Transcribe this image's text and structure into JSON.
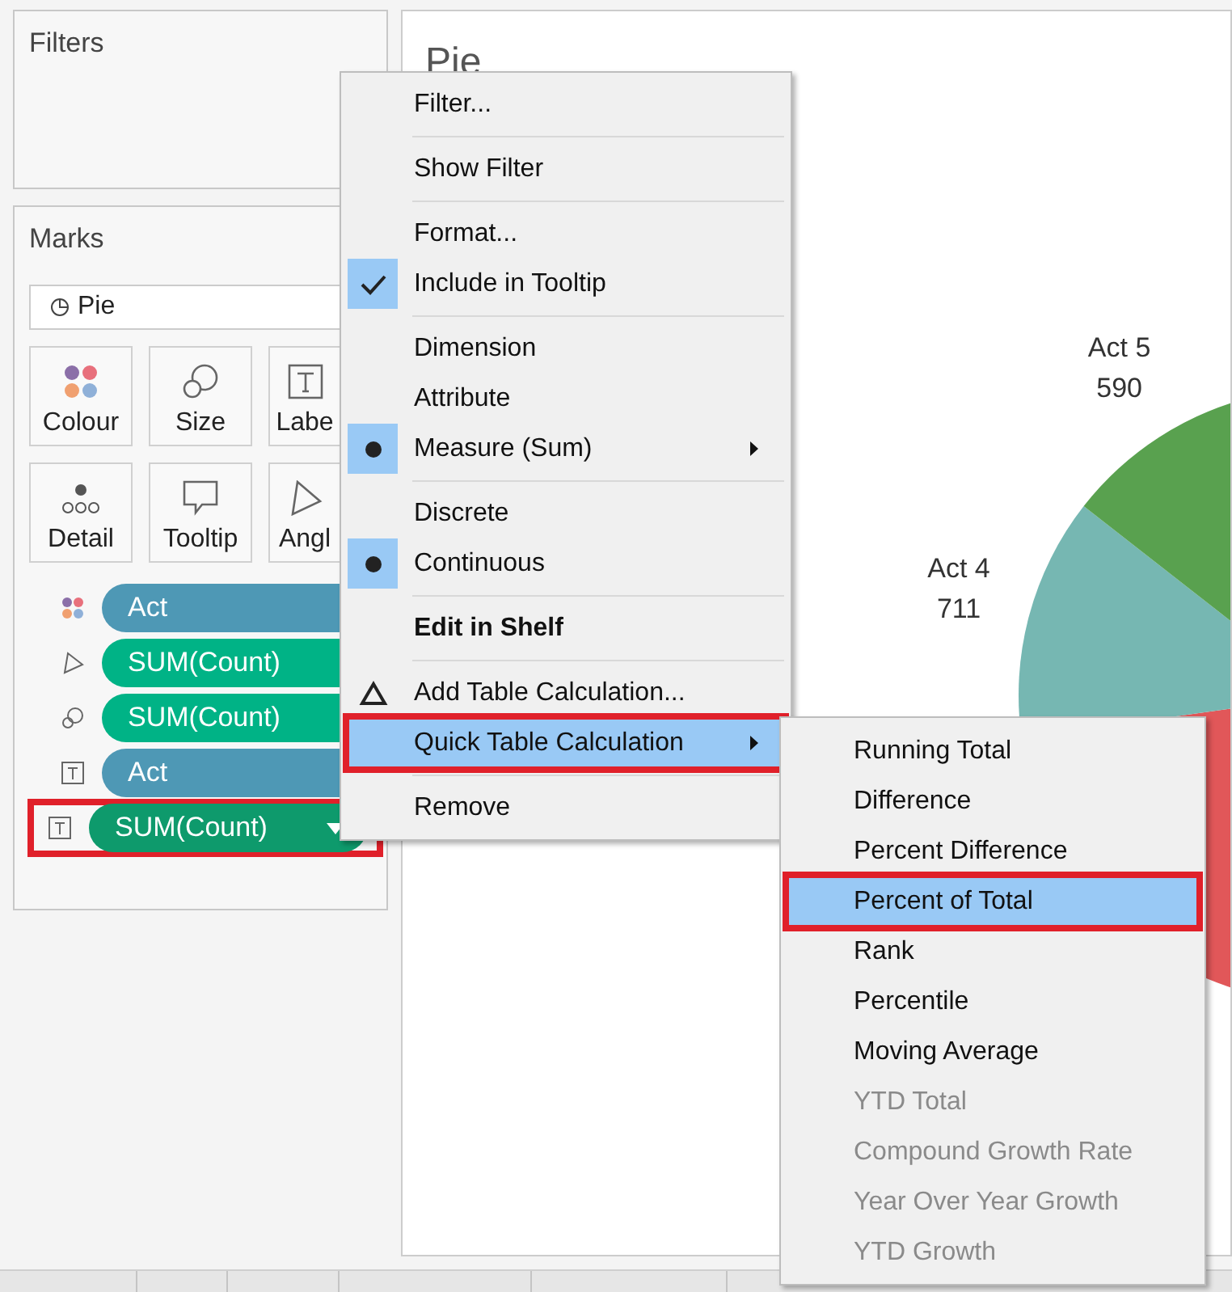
{
  "filters": {
    "title": "Filters"
  },
  "marks": {
    "title": "Marks",
    "mark_type": "Pie",
    "cards": [
      {
        "kind": "colour",
        "label": "Colour"
      },
      {
        "kind": "size",
        "label": "Size"
      },
      {
        "kind": "label",
        "label": "Labe"
      },
      {
        "kind": "detail",
        "label": "Detail"
      },
      {
        "kind": "tooltip",
        "label": "Tooltip"
      },
      {
        "kind": "angle",
        "label": "Angl"
      }
    ],
    "pills": [
      {
        "kind": "colour",
        "label": "Act",
        "color": "#4e98b5",
        "selected": false,
        "outlined": false
      },
      {
        "kind": "angle",
        "label": "SUM(Count)",
        "color": "#00b386",
        "selected": false,
        "outlined": false
      },
      {
        "kind": "size",
        "label": "SUM(Count)",
        "color": "#00b386",
        "selected": false,
        "outlined": false
      },
      {
        "kind": "label",
        "label": "Act",
        "color": "#4e98b5",
        "selected": false,
        "outlined": false
      },
      {
        "kind": "label",
        "label": "SUM(Count)",
        "color": "#0e9a6c",
        "selected": true,
        "outlined": true
      }
    ]
  },
  "view": {
    "title": "Pie",
    "pie": {
      "slices": [
        {
          "color": "#e15759"
        },
        {
          "label": "Act 4",
          "value": "711",
          "color": "#76b7b2"
        },
        {
          "label": "Act 5",
          "value": "590",
          "color": "#59a14f"
        }
      ]
    }
  },
  "context_menu": {
    "groups": [
      [
        {
          "kind": "plain",
          "label": "Filter...",
          "selected": false
        }
      ],
      [
        {
          "kind": "plain",
          "label": "Show Filter",
          "selected": false
        }
      ],
      [
        {
          "kind": "plain",
          "label": "Format...",
          "selected": false
        },
        {
          "kind": "check",
          "label": "Include in Tooltip",
          "selected": false
        }
      ],
      [
        {
          "kind": "plain",
          "label": "Dimension",
          "selected": false
        },
        {
          "kind": "plain",
          "label": "Attribute",
          "selected": false
        },
        {
          "kind": "radio",
          "label": "Measure (Sum)",
          "submenu": true,
          "selected": false
        }
      ],
      [
        {
          "kind": "plain",
          "label": "Discrete",
          "selected": false
        },
        {
          "kind": "radio",
          "label": "Continuous",
          "selected": false
        }
      ],
      [
        {
          "kind": "plain",
          "label": "Edit in Shelf",
          "bold": true,
          "selected": false
        }
      ],
      [
        {
          "kind": "delta",
          "label": "Add Table Calculation...",
          "selected": false
        },
        {
          "kind": "plain",
          "label": "Quick Table Calculation",
          "submenu": true,
          "selected": true,
          "outlined": true
        }
      ],
      [
        {
          "kind": "plain",
          "label": "Remove",
          "selected": false
        }
      ]
    ]
  },
  "submenu": {
    "items": [
      {
        "label": "Running Total",
        "disabled": false,
        "selected": false
      },
      {
        "label": "Difference",
        "disabled": false,
        "selected": false
      },
      {
        "label": "Percent Difference",
        "disabled": false,
        "selected": false
      },
      {
        "label": "Percent of Total",
        "disabled": false,
        "selected": true,
        "outlined": true
      },
      {
        "label": "Rank",
        "disabled": false,
        "selected": false
      },
      {
        "label": "Percentile",
        "disabled": false,
        "selected": false
      },
      {
        "label": "Moving Average",
        "disabled": false,
        "selected": false
      },
      {
        "label": "YTD Total",
        "disabled": true,
        "selected": false
      },
      {
        "label": "Compound Growth Rate",
        "disabled": true,
        "selected": false
      },
      {
        "label": "Year Over Year Growth",
        "disabled": true,
        "selected": false
      },
      {
        "label": "YTD Growth",
        "disabled": true,
        "selected": false
      }
    ]
  }
}
